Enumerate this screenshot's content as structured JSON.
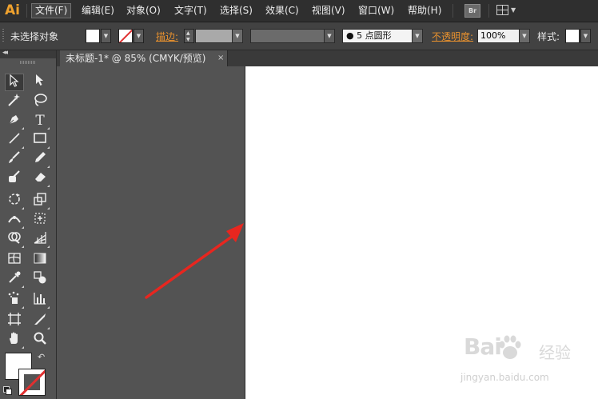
{
  "app": {
    "logo": "Ai"
  },
  "menu": {
    "items": [
      "文件(F)",
      "编辑(E)",
      "对象(O)",
      "文字(T)",
      "选择(S)",
      "效果(C)",
      "视图(V)",
      "窗口(W)",
      "帮助(H)"
    ],
    "active_index": 0,
    "bridge_label": "Br"
  },
  "control_bar": {
    "selection_label": "未选择对象",
    "stroke_label": "描边:",
    "brush_value": "5 点圆形",
    "opacity_label": "不透明度:",
    "opacity_value": "100%",
    "style_label": "样式:"
  },
  "document": {
    "tab_title": "未标题-1* @ 85% (CMYK/预览)",
    "close_glyph": "×"
  },
  "watermark": {
    "brand": "Bai",
    "brand_suffix": "经验",
    "url": "jingyan.baidu.com"
  },
  "colors": {
    "accent": "#f0a22e",
    "link_orange": "#e8912e",
    "annotation_arrow": "#e8261f",
    "panel_bg": "#535353",
    "artboard": "#ffffff"
  }
}
